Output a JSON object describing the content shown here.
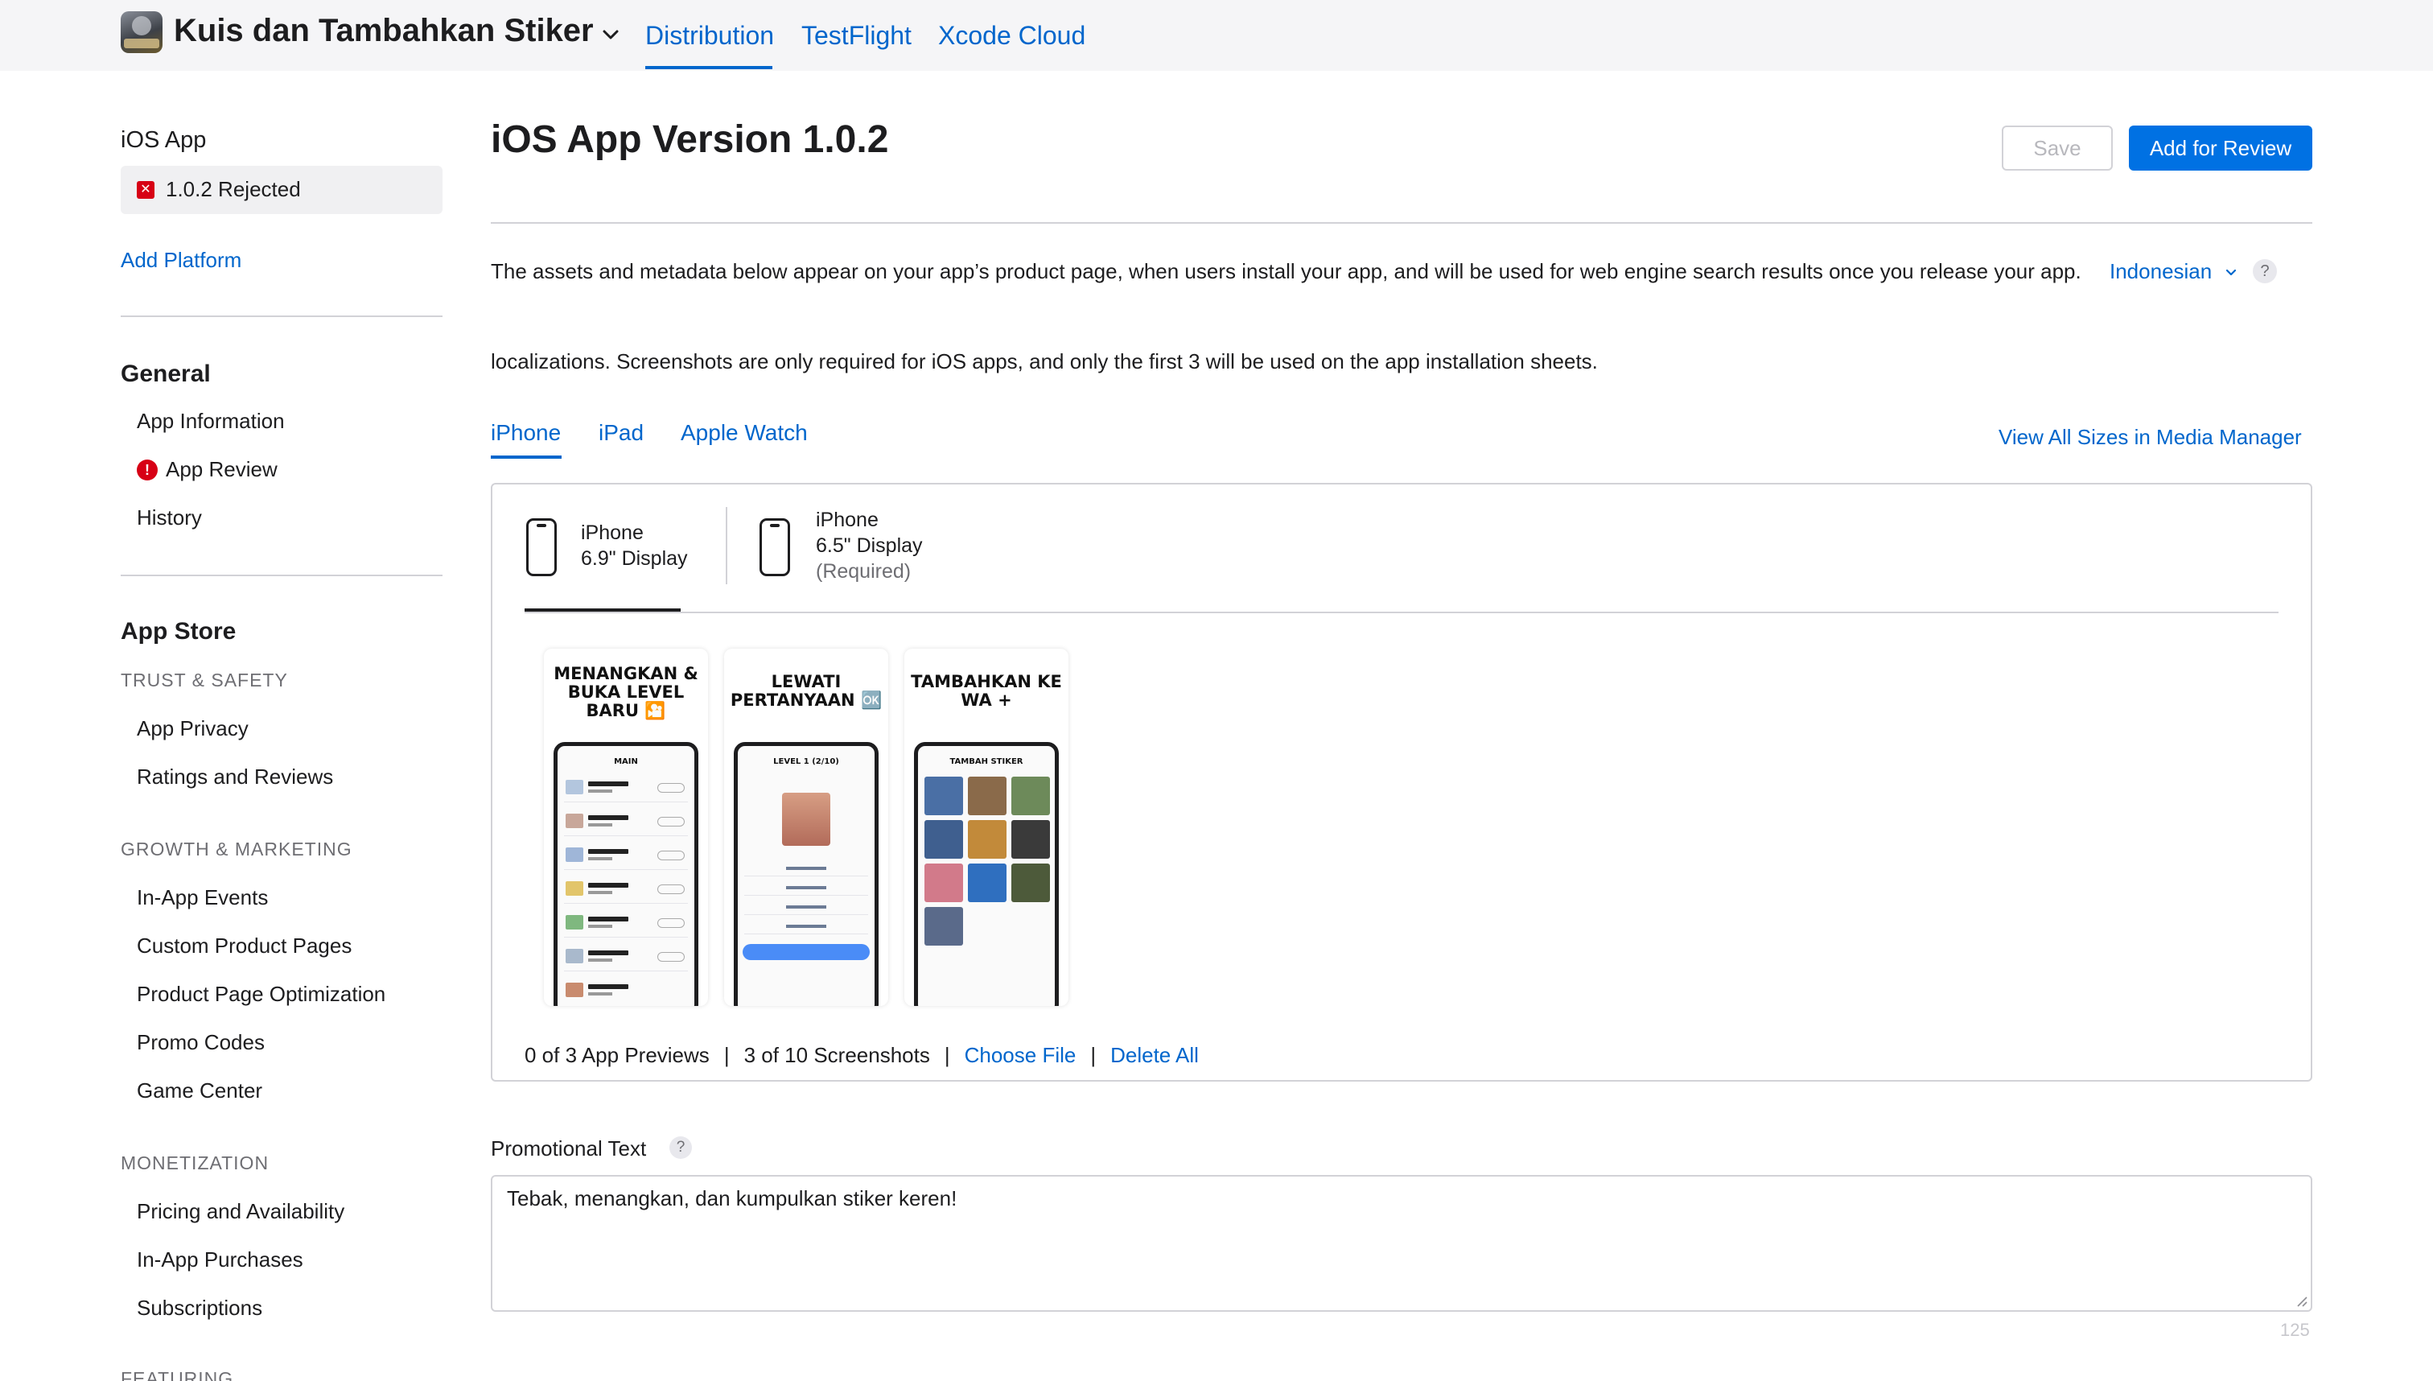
{
  "header": {
    "app_name": "Kuis dan Tambahkan Stiker",
    "tabs": [
      "Distribution",
      "TestFlight",
      "Xcode Cloud"
    ],
    "active_tab": "Distribution"
  },
  "sidebar": {
    "platform_title": "iOS App",
    "version_status": "1.0.2 Rejected",
    "add_platform": "Add Platform",
    "general": {
      "title": "General",
      "items": [
        "App Information",
        "App Review",
        "History"
      ]
    },
    "app_store": {
      "title": "App Store",
      "sections": [
        {
          "category": "TRUST & SAFETY",
          "items": [
            "App Privacy",
            "Ratings and Reviews"
          ]
        },
        {
          "category": "GROWTH & MARKETING",
          "items": [
            "In-App Events",
            "Custom Product Pages",
            "Product Page Optimization",
            "Promo Codes",
            "Game Center"
          ]
        },
        {
          "category": "MONETIZATION",
          "items": [
            "Pricing and Availability",
            "In-App Purchases",
            "Subscriptions"
          ]
        },
        {
          "category": "FEATURING",
          "items": []
        }
      ]
    }
  },
  "main": {
    "title": "iOS App Version 1.0.2",
    "save_label": "Save",
    "review_label": "Add for Review",
    "description": "The assets and metadata below appear on your app’s product page, when users install your app, and will be used for web engine search results once you release your app.",
    "description_2": "localizations. Screenshots are only required for iOS apps, and only the first 3 will be used on the app installation sheets.",
    "language": "Indonesian",
    "help": "?",
    "device_tabs": [
      "iPhone",
      "iPad",
      "Apple Watch"
    ],
    "active_device_tab": "iPhone",
    "view_all": "View All Sizes in Media Manager",
    "media": {
      "sizes": [
        {
          "line1": "iPhone",
          "line2": "6.9\" Display",
          "line3": ""
        },
        {
          "line1": "iPhone",
          "line2": "6.5\" Display",
          "line3": "(Required)"
        }
      ],
      "screenshots": [
        {
          "caption": "MENANGKAN & BUKA LEVEL BARU 🎦",
          "screen_title": "MAIN"
        },
        {
          "caption": "LEWATI PERTANYAAN 🆗",
          "screen_title": "LEVEL 1 (2/10)"
        },
        {
          "caption": "TAMBAHKAN KE WA +",
          "screen_title": "TAMBAH STIKER"
        }
      ],
      "previews_count": "0 of 3 App Previews",
      "screenshots_count": "3 of 10 Screenshots",
      "choose_file": "Choose File",
      "delete_all": "Delete All",
      "separator": "|"
    },
    "promo": {
      "label": "Promotional Text",
      "value": "Tebak, menangkan, dan kumpulkan stiker keren!",
      "char_count": "125"
    }
  },
  "colors": {
    "accent": "#0071e3",
    "link": "#0066cc",
    "error": "#d70015"
  }
}
